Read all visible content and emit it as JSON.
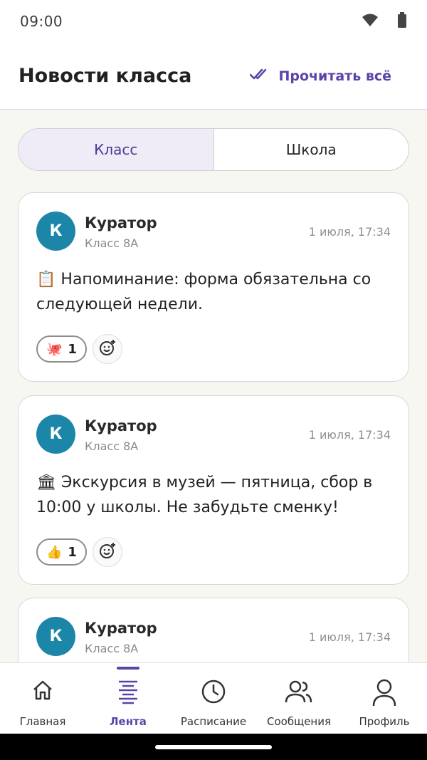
{
  "status_bar": {
    "time": "09:00",
    "icons": [
      "wifi-icon",
      "battery-icon"
    ]
  },
  "header": {
    "title": "Новости класса",
    "read_all_label": "Прочитать всё",
    "accent": "#5b44a8"
  },
  "tabs": [
    {
      "label": "Класс",
      "active": true
    },
    {
      "label": "Школа",
      "active": false
    }
  ],
  "posts": [
    {
      "avatar_letter": "К",
      "author": "Куратор",
      "group": "Класс 8А",
      "date": "1 июля, 17:34",
      "emoji": "📋",
      "text": "Напоминание: форма обязательна со следующей недели.",
      "reactions": [
        {
          "emoji": "🐙",
          "count": "1"
        }
      ]
    },
    {
      "avatar_letter": "К",
      "author": "Куратор",
      "group": "Класс 8А",
      "date": "1 июля, 17:34",
      "emoji": "🏛",
      "text": "Экскурсия в музей — пятница, сбор в 10:00 у школы. Не забудьте сменку!",
      "reactions": [
        {
          "emoji": "👍",
          "count": "1"
        }
      ]
    },
    {
      "avatar_letter": "К",
      "author": "Куратор",
      "group": "Класс 8А",
      "date": "1 июля, 17:34"
    }
  ],
  "bottom_nav": [
    {
      "label": "Главная",
      "icon": "home-icon",
      "active": false
    },
    {
      "label": "Лента",
      "icon": "feed-icon",
      "active": true
    },
    {
      "label": "Расписание",
      "icon": "clock-icon",
      "active": false
    },
    {
      "label": "Сообщения",
      "icon": "people-icon",
      "active": false
    },
    {
      "label": "Профиль",
      "icon": "profile-icon",
      "active": false
    }
  ]
}
